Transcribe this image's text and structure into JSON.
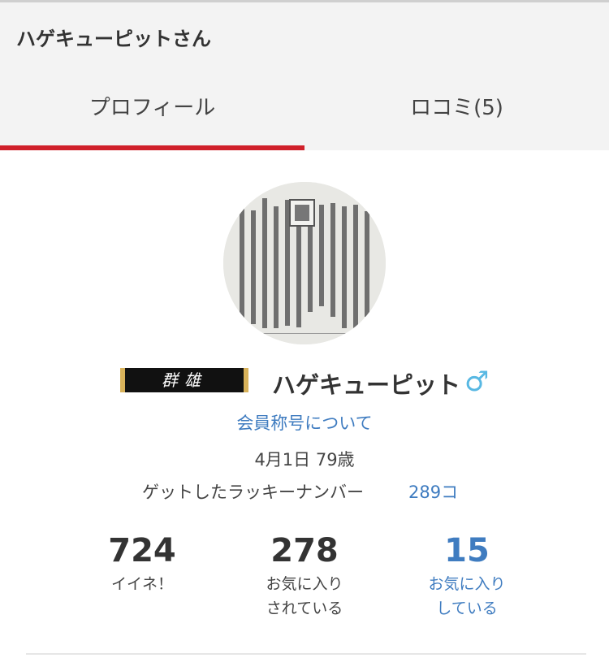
{
  "header": {
    "title": "ハゲキューピットさん",
    "tabs": [
      {
        "label": "プロフィール",
        "active": true
      },
      {
        "label": "ロコミ(5)",
        "active": false
      }
    ],
    "accent_color": "#d0202a"
  },
  "profile": {
    "badge_text": "群雄",
    "username": "ハゲキューピット",
    "gender_symbol": "♂",
    "rank_link": "会員称号について",
    "birthday": "4月1日 79歳",
    "lucky_label": "ゲットしたラッキーナンバー",
    "lucky_count": "289コ"
  },
  "stats": [
    {
      "value": "724",
      "label_line1": "イイネ！",
      "label_line2": ""
    },
    {
      "value": "278",
      "label_line1": "お気に入り",
      "label_line2": "されている"
    },
    {
      "value": "15",
      "label_line1": "お気に入り",
      "label_line2": "している"
    }
  ]
}
